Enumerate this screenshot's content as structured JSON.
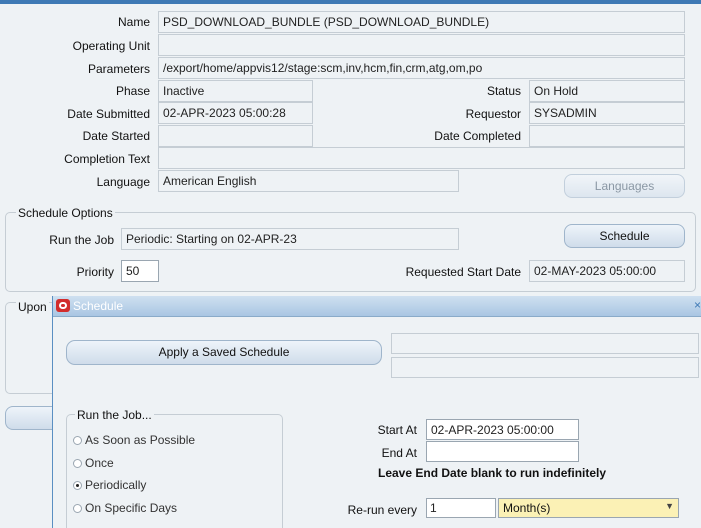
{
  "request": {
    "name_label": "Name",
    "name_value": "PSD_DOWNLOAD_BUNDLE (PSD_DOWNLOAD_BUNDLE)",
    "operating_unit_label": "Operating Unit",
    "operating_unit_value": "",
    "parameters_label": "Parameters",
    "parameters_value": "/export/home/appvis12/stage:scm,inv,hcm,fin,crm,atg,om,po",
    "phase_label": "Phase",
    "phase_value": "Inactive",
    "status_label": "Status",
    "status_value": "On Hold",
    "date_submitted_label": "Date Submitted",
    "date_submitted_value": "02-APR-2023 05:00:28",
    "requestor_label": "Requestor",
    "requestor_value": "SYSADMIN",
    "date_started_label": "Date Started",
    "date_started_value": "",
    "date_completed_label": "Date Completed",
    "date_completed_value": "",
    "completion_text_label": "Completion Text",
    "completion_text_value": "",
    "language_label": "Language",
    "language_value": "American English",
    "languages_button": "Languages"
  },
  "schedule_options": {
    "title": "Schedule Options",
    "run_the_job_label": "Run the Job",
    "run_the_job_value": "Periodic: Starting on 02-APR-23",
    "schedule_button": "Schedule",
    "priority_label": "Priority",
    "priority_value": "50",
    "requested_start_label": "Requested Start Date",
    "requested_start_value": "02-MAY-2023 05:00:00"
  },
  "upon_completion": {
    "title_partial": "Upon"
  },
  "schedule_window": {
    "title": "Schedule",
    "close_glyph": "×",
    "apply_saved_button": "Apply a Saved Schedule",
    "run_job_group_title": "Run the Job...",
    "options": [
      {
        "label": "As Soon as Possible",
        "selected": false
      },
      {
        "label": "Once",
        "selected": false
      },
      {
        "label": "Periodically",
        "selected": true
      },
      {
        "label": "On Specific Days",
        "selected": false
      }
    ],
    "start_at_label": "Start At",
    "start_at_value": "02-APR-2023 05:00:00",
    "end_at_label": "End At",
    "end_at_value": "",
    "end_note": "Leave End Date blank to run indefinitely",
    "rerun_label": "Re-run every",
    "rerun_value": "1",
    "rerun_unit": "Month(s)",
    "dropdown_icon": "chevron-down-icon"
  },
  "colors": {
    "panel_bg": "#eef2f5",
    "title_bar": "#a9c6e3",
    "highlight_field": "#fbf1b5",
    "oracle_red": "#d22c2c"
  }
}
